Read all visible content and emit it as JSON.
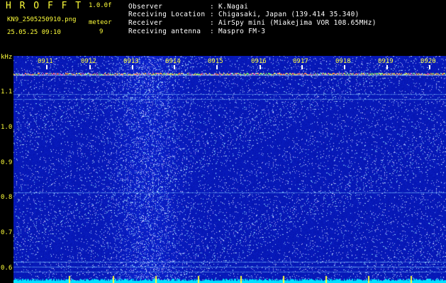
{
  "header": {
    "title": "H R O F F T",
    "version": "1.0.0f",
    "filename": "KN9_2505250910.png",
    "meteor_label": "meteor",
    "meteor_count": "9",
    "datetime": "25.05.25 09:10"
  },
  "station": {
    "observer_label": "Observer",
    "observer_value": ": K.Nagai",
    "location_label": "Receiving Location",
    "location_value": ": Chigasaki, Japan (139.414 35.340)",
    "receiver_label": "Receiver",
    "receiver_value": ": AirSpy mini (Miakejima VOR 108.65MHz)",
    "antenna_label": "Receiving antenna",
    "antenna_value": ": Maspro FM-3"
  },
  "plot": {
    "yunit": "kHz",
    "xticks": [
      "0911",
      "0912",
      "0913",
      "0914",
      "0915",
      "0916",
      "0917",
      "0918",
      "0919",
      "0920"
    ],
    "yticks": [
      "1.1",
      "1.0",
      "0.9",
      "0.8",
      "0.7",
      "0.6"
    ],
    "colors": {
      "background": "#1a2bb0",
      "noise_light": "#8fb6ff",
      "carrier_line": "#ff5ab4",
      "baseline": "#00e5ff",
      "label": "#ffff3a"
    }
  }
}
